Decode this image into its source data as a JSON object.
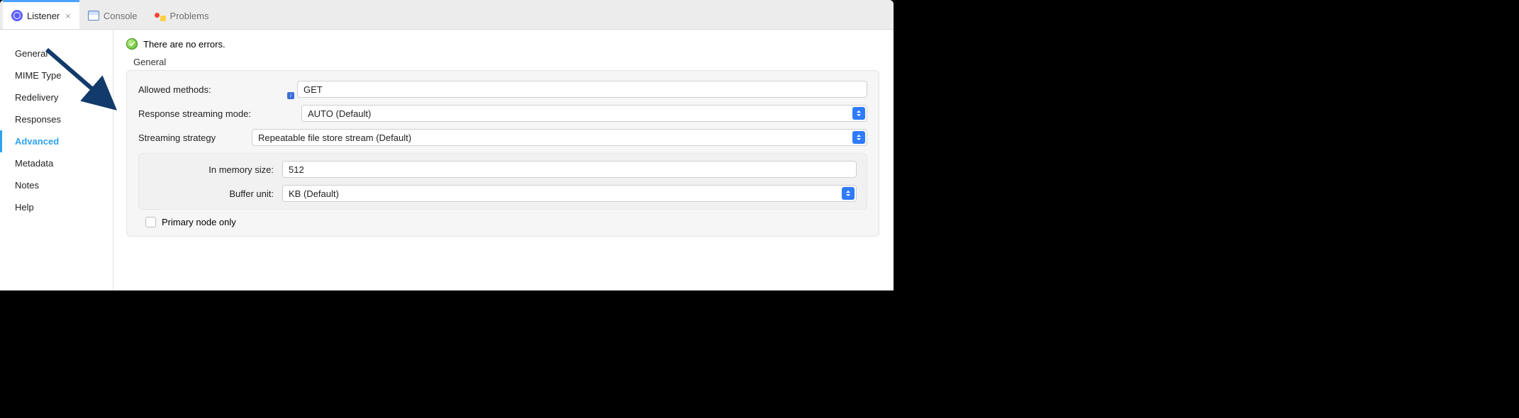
{
  "tabs": [
    {
      "label": "Listener",
      "active": true,
      "closable": true
    },
    {
      "label": "Console",
      "active": false
    },
    {
      "label": "Problems",
      "active": false
    }
  ],
  "status": {
    "message": "There are no errors."
  },
  "side_nav": {
    "items": [
      {
        "label": "General"
      },
      {
        "label": "MIME Type"
      },
      {
        "label": "Redelivery"
      },
      {
        "label": "Responses"
      },
      {
        "label": "Advanced",
        "active": true
      },
      {
        "label": "Metadata"
      },
      {
        "label": "Notes"
      },
      {
        "label": "Help"
      }
    ]
  },
  "form": {
    "section_title": "General",
    "allowed_methods": {
      "label": "Allowed methods:",
      "value": "GET"
    },
    "response_streaming_mode": {
      "label": "Response streaming mode:",
      "value": "AUTO (Default)"
    },
    "streaming_strategy": {
      "label": "Streaming strategy",
      "value": "Repeatable file store stream (Default)"
    },
    "in_memory_size": {
      "label": "In memory size:",
      "value": "512"
    },
    "buffer_unit": {
      "label": "Buffer unit:",
      "value": "KB (Default)"
    },
    "primary_node_only": {
      "label": "Primary node only",
      "checked": false
    }
  }
}
